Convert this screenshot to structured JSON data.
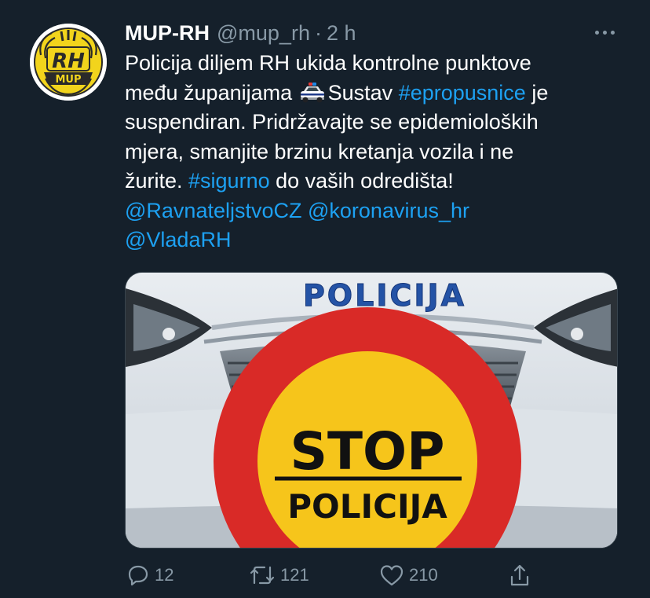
{
  "tweet": {
    "author": {
      "display_name": "MUP-RH",
      "handle": "@mup_rh",
      "separator": "·",
      "time": "2 h",
      "avatar_text_top": "RH",
      "avatar_text_bottom": "MUP"
    },
    "text": {
      "line1": "Policija diljem RH ukida kontrolne punktove",
      "line2_a": "među županijama ",
      "line2_b": "Sustav ",
      "hashtag1": "#epropusnice",
      "line2_c": " je",
      "line3": "suspendiran. Pridržavajte se epidemioloških",
      "line4": "mjera, smanjite brzinu kretanja vozila i ne",
      "line5_a": "žurite. ",
      "hashtag2": "#sigurno",
      "line5_b": " do vaših odredišta!",
      "mention1": "@RavnateljstvoCZ",
      "mention2": "@koronavirus_hr",
      "mention3": "@VladaRH",
      "emoji": "police-car-emoji"
    },
    "media": {
      "car_label": "POLICIJA",
      "sign_top": "STOP",
      "sign_bottom": "POLICIJA"
    },
    "actions": {
      "reply_count": "12",
      "retweet_count": "121",
      "like_count": "210",
      "icons": [
        "reply-icon",
        "retweet-icon",
        "like-icon",
        "share-icon"
      ]
    }
  },
  "colors": {
    "background": "#15202b",
    "text": "#ffffff",
    "muted": "#8899a6",
    "link": "#1da1f2"
  }
}
